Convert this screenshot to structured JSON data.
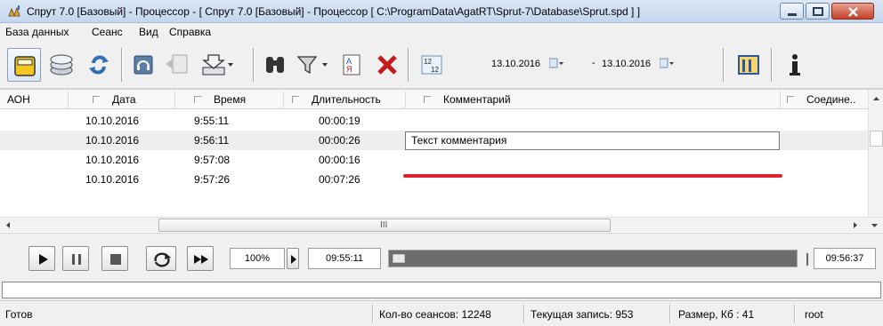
{
  "window": {
    "title": "Спрут 7.0 [Базовый] - Процессор - [ Спрут 7.0 [Базовый] - Процессор [ C:\\ProgramData\\AgatRT\\Sprut-7\\Database\\Sprut.spd ] ]",
    "icons": {
      "app": "app-hand-icon",
      "minimize": "minimize-icon",
      "maximize": "maximize-icon",
      "close": "close-icon"
    }
  },
  "menu": {
    "items": [
      "База данных",
      "Сеанс",
      "Вид",
      "Справка"
    ]
  },
  "toolbar": {
    "icons": [
      "database-open-icon",
      "disks-icon",
      "refresh-icon",
      "headset-icon",
      "export-icon",
      "download-icon",
      "binoculars-icon",
      "filter-icon",
      "alphabet-sort-icon",
      "delete-icon",
      "date-range-icon",
      "columns-icon",
      "info-icon"
    ],
    "date_from": "13.10.2016",
    "date_sep": "-",
    "date_to": "13.10.2016"
  },
  "grid": {
    "columns": [
      "АОН",
      "Дата",
      "Время",
      "Длительность",
      "Комментарий",
      "Соедине.."
    ],
    "rows": [
      {
        "aon": "",
        "date": "10.10.2016",
        "time": "9:55:11",
        "duration": "00:00:19",
        "comment": ""
      },
      {
        "aon": "",
        "date": "10.10.2016",
        "time": "9:56:11",
        "duration": "00:00:26",
        "comment": "Текст комментария"
      },
      {
        "aon": "",
        "date": "10.10.2016",
        "time": "9:57:08",
        "duration": "00:00:16",
        "comment": ""
      },
      {
        "aon": "",
        "date": "10.10.2016",
        "time": "9:57:26",
        "duration": "00:07:26",
        "comment": ""
      }
    ],
    "hscroll_grip": "III",
    "accent_color": "#e0232b"
  },
  "player": {
    "speed": "100%",
    "start_time": "09:55:11",
    "end_time": "09:56:37",
    "icons": [
      "play-icon",
      "pause-icon",
      "stop-icon",
      "loop-icon",
      "fast-forward-icon",
      "step-right-icon"
    ]
  },
  "status": {
    "ready": "Готов",
    "sessions": "Кол-во сеансов: 12248",
    "current": "Текущая запись: 953",
    "size": "Размер, Кб : 41",
    "user": "root"
  }
}
